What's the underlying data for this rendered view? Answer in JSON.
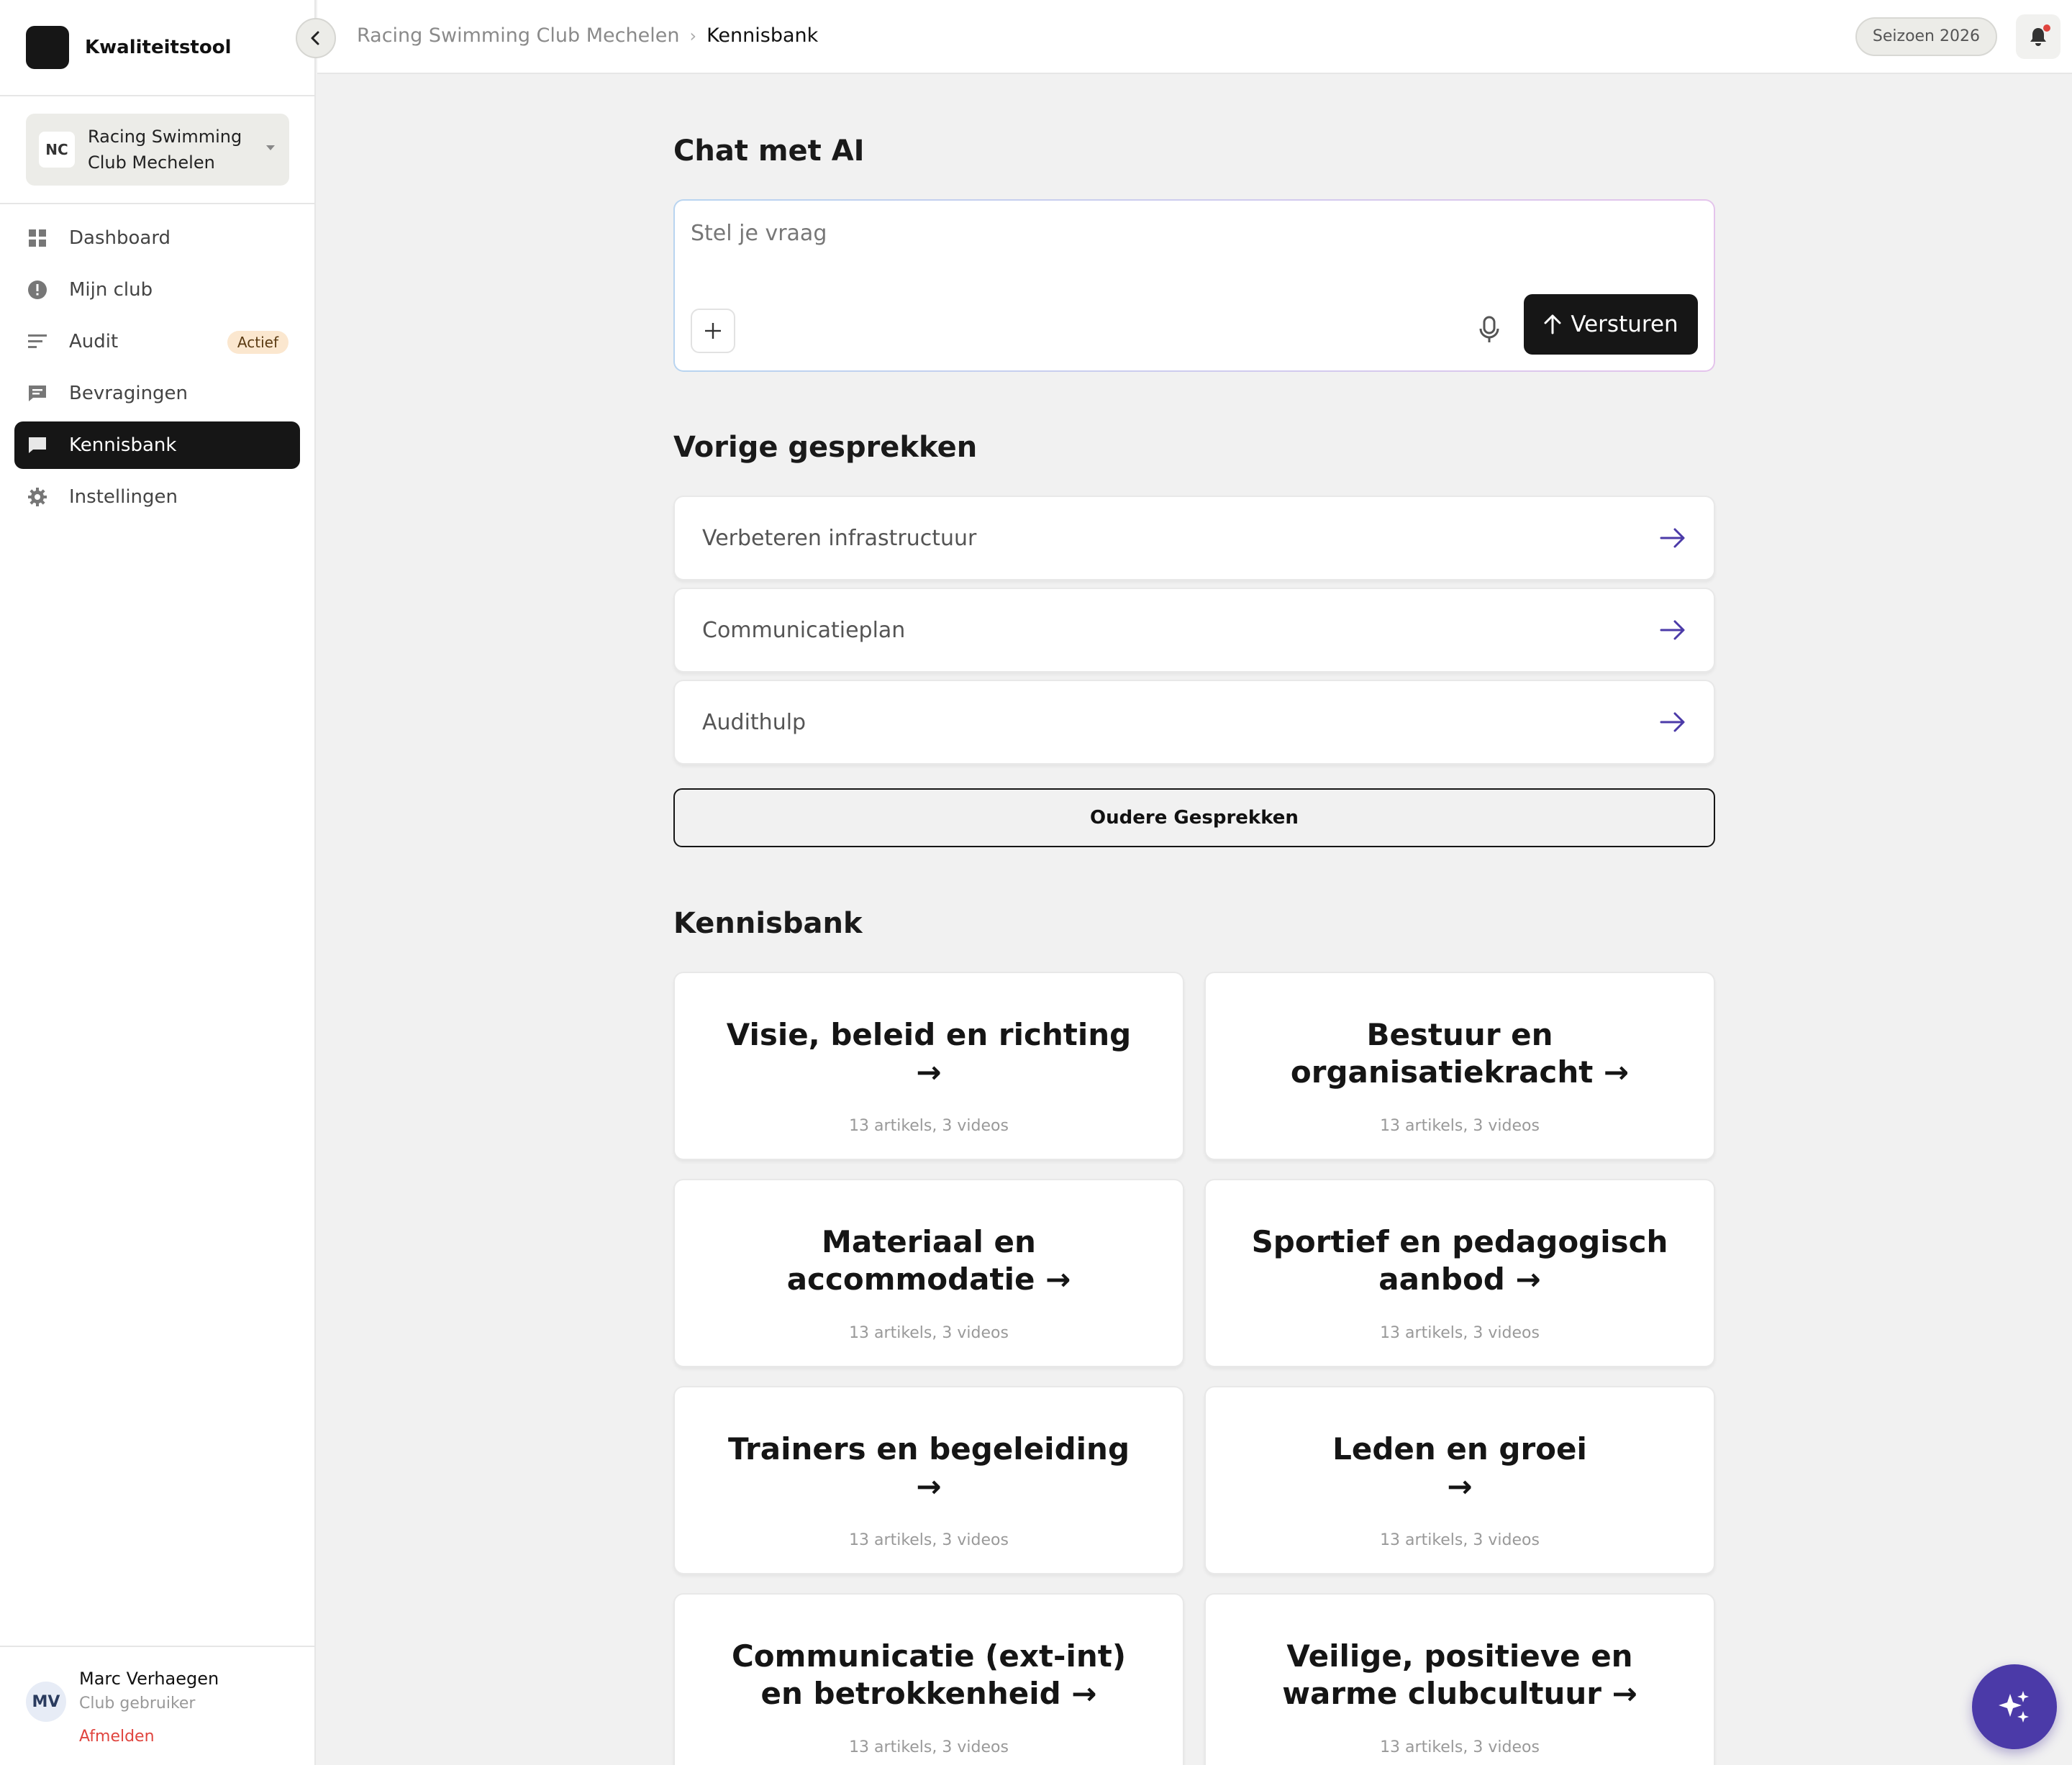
{
  "app": {
    "title": "Kwaliteitstool"
  },
  "club_selector": {
    "initials": "NC",
    "name": "Racing Swimming Club Mechelen"
  },
  "nav": {
    "items": [
      {
        "label": "Dashboard",
        "icon": "grid-icon"
      },
      {
        "label": "Mijn club",
        "icon": "info-icon"
      },
      {
        "label": "Audit",
        "icon": "lines-icon",
        "badge": "Actief"
      },
      {
        "label": "Bevragingen",
        "icon": "message-icon"
      },
      {
        "label": "Kennisbank",
        "icon": "chat-icon",
        "active": true
      },
      {
        "label": "Instellingen",
        "icon": "gear-icon"
      }
    ]
  },
  "user": {
    "initials": "MV",
    "name": "Marc Verhaegen",
    "role": "Club gebruiker",
    "logout": "Afmelden"
  },
  "breadcrumb": {
    "parent": "Racing Swimming Club Mechelen",
    "separator": "›",
    "current": "Kennisbank"
  },
  "topbar": {
    "season": "Seizoen 2026"
  },
  "chat": {
    "title": "Chat met AI",
    "placeholder": "Stel je vraag",
    "send_label": "Versturen"
  },
  "previous": {
    "title": "Vorige gesprekken",
    "items": [
      {
        "label": "Verbeteren infrastructuur"
      },
      {
        "label": "Communicatieplan"
      },
      {
        "label": "Audithulp"
      }
    ],
    "older_label": "Oudere Gesprekken"
  },
  "kennisbank": {
    "title": "Kennisbank",
    "cards": [
      {
        "line1": "Visie, beleid en richting",
        "line2": "→",
        "meta": "13 artikels, 3 videos"
      },
      {
        "line1": "Bestuur en",
        "line2": "organisatiekracht →",
        "meta": "13 artikels, 3 videos"
      },
      {
        "line1": "Materiaal en",
        "line2": "accommodatie →",
        "meta": "13 artikels, 3 videos"
      },
      {
        "line1": "Sportief en pedagogisch",
        "line2": "aanbod →",
        "meta": "13 artikels, 3 videos"
      },
      {
        "line1": "Trainers en begeleiding",
        "line2": "→",
        "meta": "13 artikels, 3 videos"
      },
      {
        "line1": "Leden en groei",
        "line2": "→",
        "meta": "13 artikels, 3 videos"
      },
      {
        "line1": "Communicatie (ext-int)",
        "line2": "en betrokkenheid →",
        "meta": "13 artikels, 3 videos"
      },
      {
        "line1": "Veilige, positieve en",
        "line2": "warme clubcultuur →",
        "meta": "13 artikels, 3 videos"
      }
    ]
  },
  "colors": {
    "accent": "#4b3aa8",
    "dark": "#161616",
    "badge_bg": "#fbe7cf",
    "logout": "#e0443e"
  }
}
